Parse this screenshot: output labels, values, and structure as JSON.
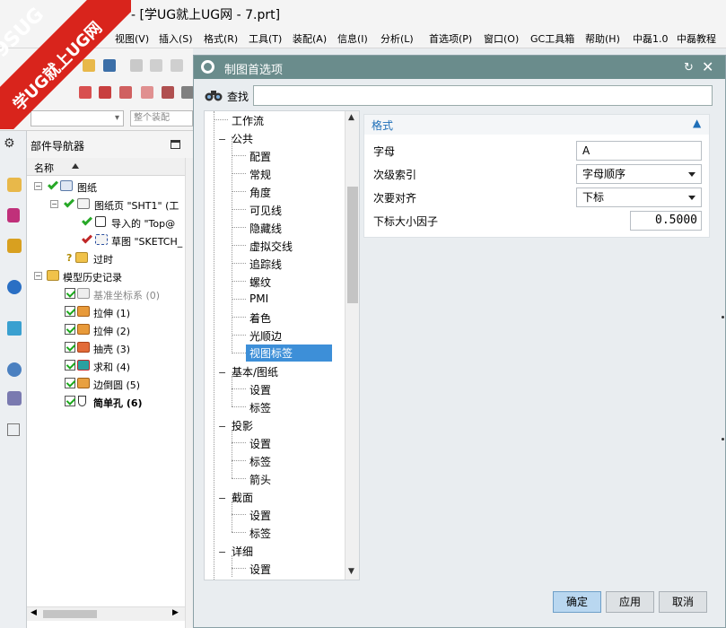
{
  "window": {
    "title": "- [学UG就上UG网 - 7.prt]"
  },
  "watermark": {
    "line1": "9SUG",
    "line2": "学UG就上UG网"
  },
  "menu": [
    "视图(V)",
    "插入(S)",
    "格式(R)",
    "工具(T)",
    "装配(A)",
    "信息(I)",
    "分析(L)",
    "首选项(P)",
    "窗口(O)",
    "GC工具箱",
    "帮助(H)",
    "中磊1.0",
    "中磊教程"
  ],
  "toolbar": {
    "filter_placeholder": "",
    "assembly_scope": "整个装配"
  },
  "navigator": {
    "title": "部件导航器",
    "column_name": "名称",
    "rows": [
      {
        "label": "图纸"
      },
      {
        "label": "图纸页 \"SHT1\" (工"
      },
      {
        "label": "导入的 \"Top@"
      },
      {
        "label": "草图 \"SKETCH_"
      },
      {
        "label": "过时"
      },
      {
        "label": "模型历史记录"
      },
      {
        "label": "基准坐标系 (0)"
      },
      {
        "label": "拉伸 (1)"
      },
      {
        "label": "拉伸 (2)"
      },
      {
        "label": "抽壳 (3)"
      },
      {
        "label": "求和 (4)"
      },
      {
        "label": "边倒圆 (5)"
      },
      {
        "label": "简单孔 (6)"
      }
    ]
  },
  "dialog": {
    "title": "制图首选项",
    "find_label": "查找",
    "find_value": "",
    "tree": [
      {
        "label": "工作流"
      },
      {
        "label": "公共"
      },
      {
        "label": "配置"
      },
      {
        "label": "常规"
      },
      {
        "label": "角度"
      },
      {
        "label": "可见线"
      },
      {
        "label": "隐藏线"
      },
      {
        "label": "虚拟交线"
      },
      {
        "label": "追踪线"
      },
      {
        "label": "螺纹"
      },
      {
        "label": "PMI"
      },
      {
        "label": "着色"
      },
      {
        "label": "光顺边"
      },
      {
        "label": "视图标签"
      },
      {
        "label": "基本/图纸"
      },
      {
        "label": "设置"
      },
      {
        "label": "标签"
      },
      {
        "label": "投影"
      },
      {
        "label": "设置"
      },
      {
        "label": "标签"
      },
      {
        "label": "箭头"
      },
      {
        "label": "截面"
      },
      {
        "label": "设置"
      },
      {
        "label": "标签"
      },
      {
        "label": "详细"
      },
      {
        "label": "设置"
      }
    ],
    "group_title": "格式",
    "fields": {
      "letter_label": "字母",
      "letter_value": "A",
      "sub_index_label": "次级索引",
      "sub_index_value": "字母顺序",
      "sub_align_label": "次要对齐",
      "sub_align_value": "下标",
      "subscript_scale_label": "下标大小因子",
      "subscript_scale_value": "0.5000"
    },
    "buttons": {
      "ok": "确定",
      "apply": "应用",
      "cancel": "取消"
    }
  }
}
